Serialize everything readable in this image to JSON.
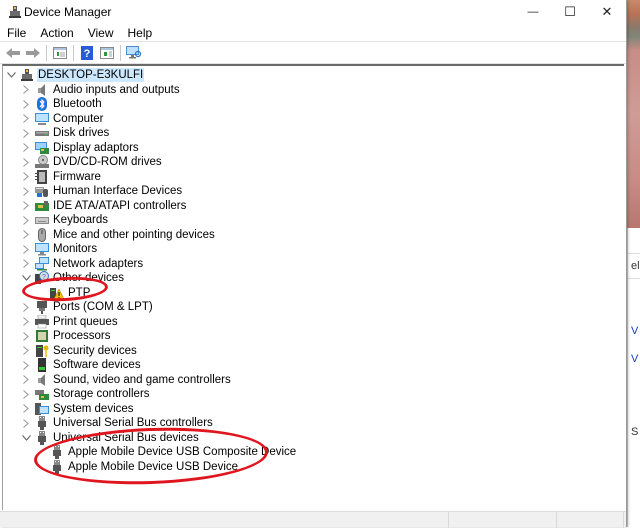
{
  "window": {
    "title": "Device Manager",
    "controls": {
      "minimize": "—",
      "maximize": "☐",
      "close": "✕"
    }
  },
  "menu": [
    "File",
    "Action",
    "View",
    "Help"
  ],
  "toolbar": {
    "buttons": [
      {
        "name": "back-button",
        "icon": "arrow-left-icon"
      },
      {
        "name": "forward-button",
        "icon": "arrow-right-icon"
      },
      {
        "name": "show-hide-console-tree-button",
        "icon": "console-tree-icon"
      },
      {
        "name": "help-button",
        "icon": "help-icon"
      },
      {
        "name": "show-hide-action-pane-button",
        "icon": "action-pane-icon"
      },
      {
        "name": "scan-hardware-button",
        "icon": "monitor-scan-icon"
      }
    ]
  },
  "tree": {
    "root": {
      "label": "DESKTOP-E3KULFI",
      "expanded": true,
      "selected": true
    },
    "categories": [
      {
        "label": "Audio inputs and outputs",
        "icon": "speaker-icon",
        "expanded": false
      },
      {
        "label": "Bluetooth",
        "icon": "bluetooth-icon",
        "expanded": false
      },
      {
        "label": "Computer",
        "icon": "computer-icon",
        "expanded": false
      },
      {
        "label": "Disk drives",
        "icon": "disk-drive-icon",
        "expanded": false
      },
      {
        "label": "Display adaptors",
        "icon": "display-adapter-icon",
        "expanded": false
      },
      {
        "label": "DVD/CD-ROM drives",
        "icon": "dvd-drive-icon",
        "expanded": false
      },
      {
        "label": "Firmware",
        "icon": "firmware-icon",
        "expanded": false
      },
      {
        "label": "Human Interface Devices",
        "icon": "hid-icon",
        "expanded": false
      },
      {
        "label": "IDE ATA/ATAPI controllers",
        "icon": "ide-controller-icon",
        "expanded": false
      },
      {
        "label": "Keyboards",
        "icon": "keyboard-icon",
        "expanded": false
      },
      {
        "label": "Mice and other pointing devices",
        "icon": "mouse-icon",
        "expanded": false
      },
      {
        "label": "Monitors",
        "icon": "monitor-icon",
        "expanded": false
      },
      {
        "label": "Network adapters",
        "icon": "network-adapter-icon",
        "expanded": false
      },
      {
        "label": "Other devices",
        "icon": "unknown-device-icon",
        "expanded": true,
        "children": [
          {
            "label": "PTP",
            "icon": "warning-device-icon",
            "status": "warning"
          }
        ]
      },
      {
        "label": "Ports (COM & LPT)",
        "icon": "port-icon",
        "expanded": false
      },
      {
        "label": "Print queues",
        "icon": "printer-icon",
        "expanded": false
      },
      {
        "label": "Processors",
        "icon": "processor-icon",
        "expanded": false
      },
      {
        "label": "Security devices",
        "icon": "security-device-icon",
        "expanded": false
      },
      {
        "label": "Software devices",
        "icon": "software-device-icon",
        "expanded": false
      },
      {
        "label": "Sound, video and game controllers",
        "icon": "sound-icon",
        "expanded": false
      },
      {
        "label": "Storage controllers",
        "icon": "storage-controller-icon",
        "expanded": false
      },
      {
        "label": "System devices",
        "icon": "system-device-icon",
        "expanded": false
      },
      {
        "label": "Universal Serial Bus controllers",
        "icon": "usb-icon",
        "expanded": false
      },
      {
        "label": "Universal Serial Bus devices",
        "icon": "usb-icon",
        "expanded": true,
        "children": [
          {
            "label": "Apple Mobile Device USB Composite Device",
            "icon": "usb-icon"
          },
          {
            "label": "Apple Mobile Device USB Device",
            "icon": "usb-icon"
          }
        ]
      }
    ]
  },
  "annotations": {
    "color": "#e0161e",
    "highlights": [
      "PTP",
      "Universal Serial Bus devices children"
    ]
  },
  "background_window": {
    "partial_texts": [
      "el",
      "V",
      "V",
      "S"
    ]
  },
  "colors": {
    "selection": "#cce8ff",
    "annotation_red": "#e0161e",
    "statusbar": "#f0f0f0"
  }
}
